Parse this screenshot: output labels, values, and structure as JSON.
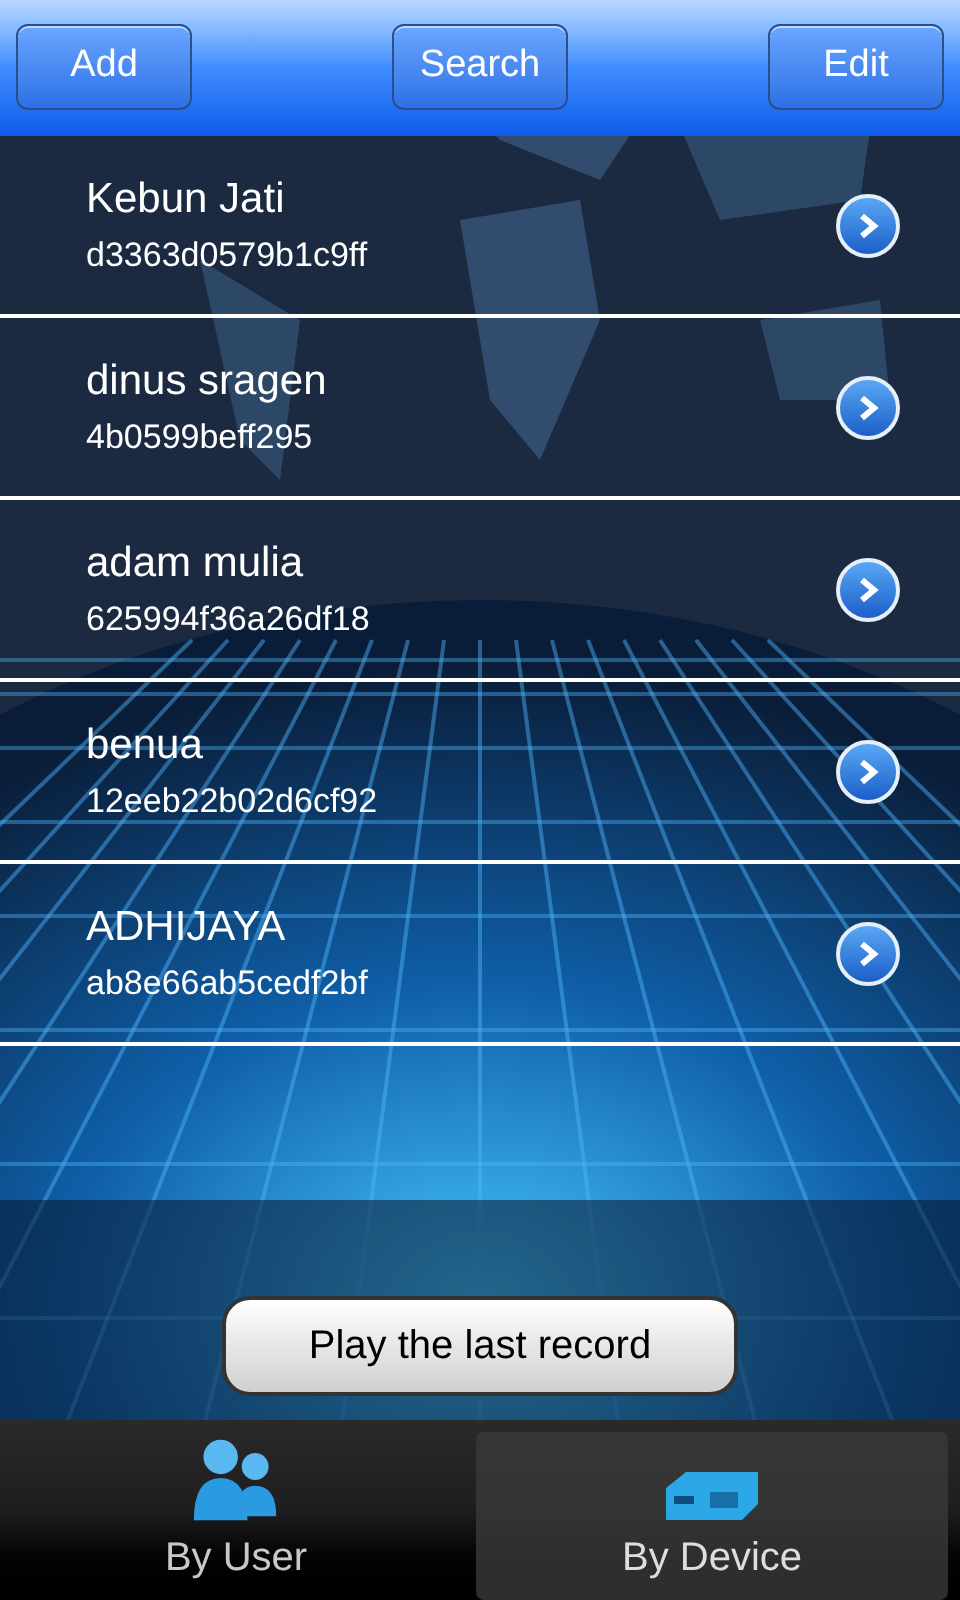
{
  "toolbar": {
    "buttons": [
      "Add",
      "Search",
      "Edit"
    ]
  },
  "records": [
    {
      "name": "Kebun Jati",
      "id": "d3363d0579b1c9ff"
    },
    {
      "name": "dinus sragen",
      "id": "4b0599beff295"
    },
    {
      "name": "adam mulia",
      "id": "625994f36a26df18"
    },
    {
      "name": "benua",
      "id": "12eeb22b02d6cf92"
    },
    {
      "name": "ADHIJAYA",
      "id": "ab8e66ab5cedf2bf"
    }
  ],
  "play_button": "Play the last record",
  "tabs": [
    {
      "label": "By User",
      "kind": "user",
      "selected": false
    },
    {
      "label": "By Device",
      "kind": "device",
      "selected": true
    }
  ]
}
